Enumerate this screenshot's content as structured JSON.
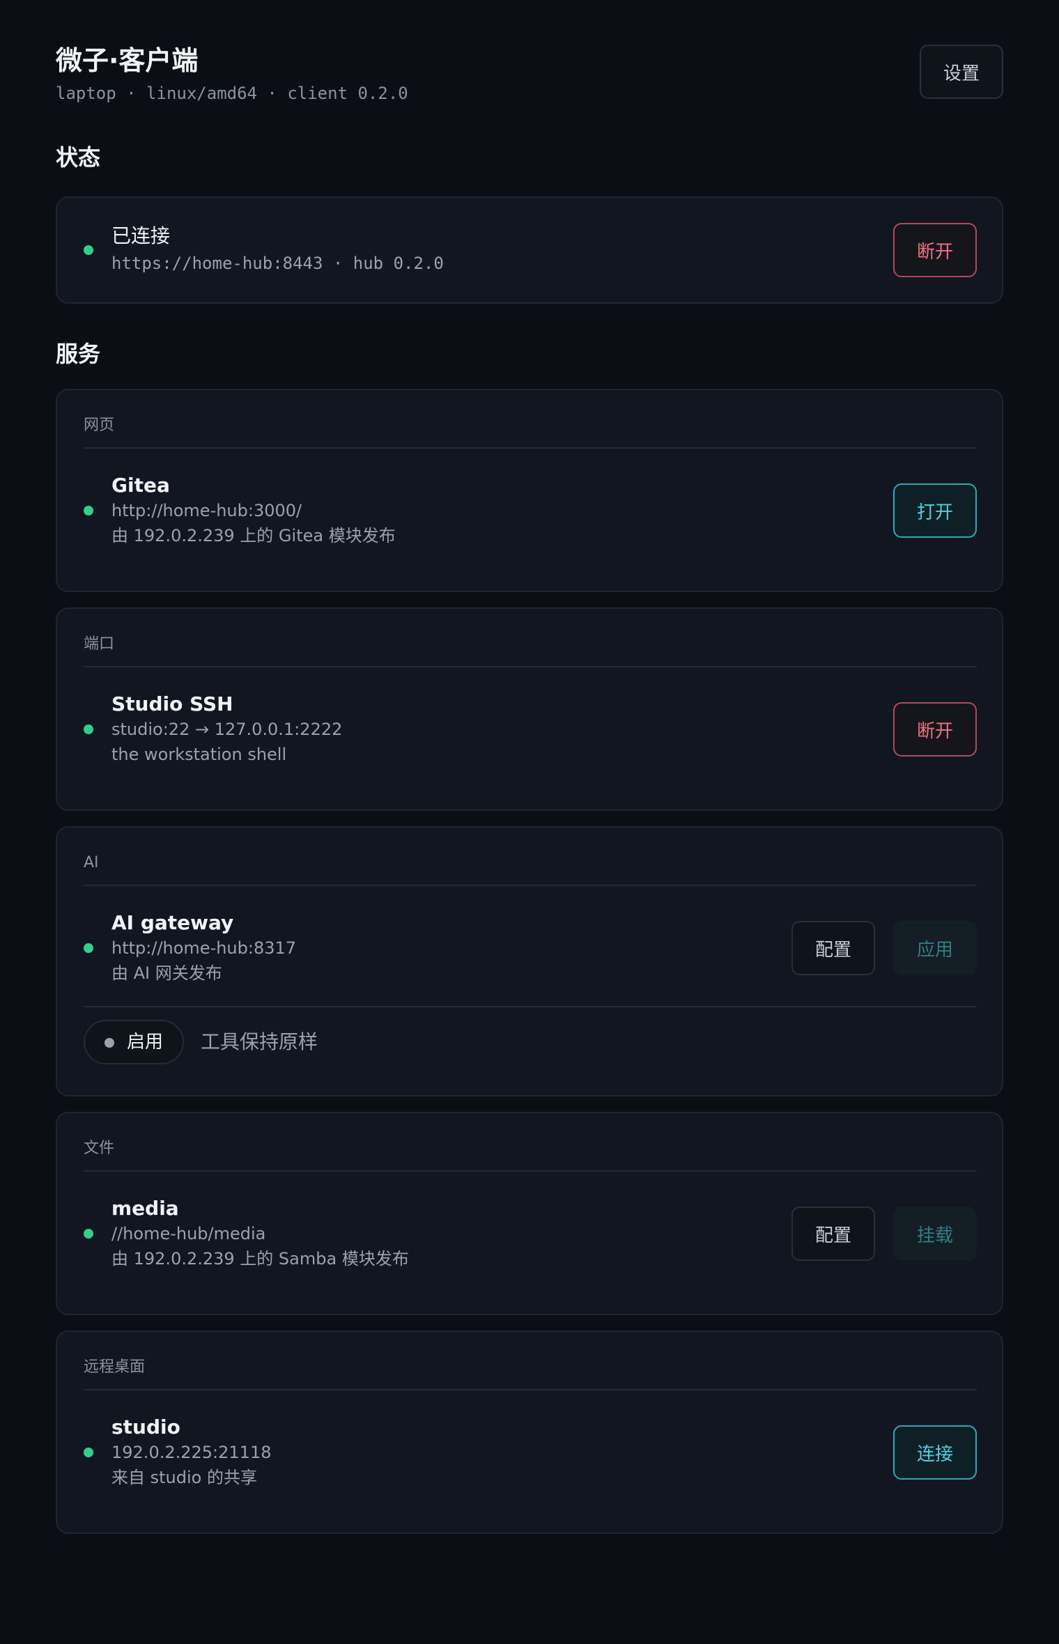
{
  "header": {
    "title": "微子·客户端",
    "subtitle": "laptop · linux/amd64 · client 0.2.0",
    "settings_label": "设置"
  },
  "status": {
    "section_title": "状态",
    "state": "已连接",
    "detail": "https://home-hub:8443 · hub 0.2.0",
    "disconnect_label": "断开",
    "indicator_color": "#2fd08c"
  },
  "services": {
    "section_title": "服务",
    "web": {
      "category": "网页",
      "name": "Gitea",
      "url": "http://home-hub:3000/",
      "description": "由 192.0.2.239 上的 Gitea 模块发布",
      "action_label": "打开"
    },
    "port": {
      "category": "端口",
      "name": "Studio SSH",
      "mapping": "studio:22 → 127.0.0.1:2222",
      "description": "the workstation shell",
      "action_label": "断开"
    },
    "ai": {
      "category": "AI",
      "name": "AI gateway",
      "url": "http://home-hub:8317",
      "description": "由 AI 网关发布",
      "config_label": "配置",
      "apply_label": "应用",
      "toggle_label": "启用",
      "toggle_note": "工具保持原样"
    },
    "files": {
      "category": "文件",
      "name": "media",
      "path": "//home-hub/media",
      "description": "由 192.0.2.239 上的 Samba 模块发布",
      "config_label": "配置",
      "mount_label": "挂载"
    },
    "remote": {
      "category": "远程桌面",
      "name": "studio",
      "address": "192.0.2.225:21118",
      "description": "来自 studio 的共享",
      "connect_label": "连接"
    }
  },
  "colors": {
    "background": "#0b0e14",
    "card": "#111620",
    "accent": "#4fd0df",
    "danger": "#f07182",
    "online": "#2fd08c"
  }
}
